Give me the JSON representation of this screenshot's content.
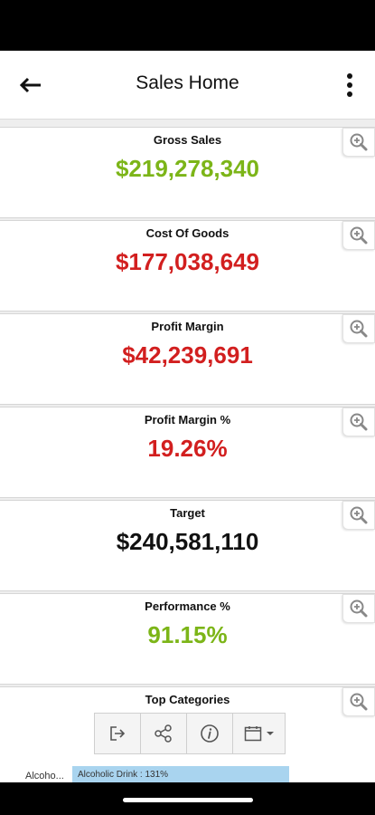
{
  "header": {
    "title": "Sales Home"
  },
  "colors": {
    "green": "#7cb518",
    "red": "#d21f1f",
    "black": "#111111"
  },
  "cards": [
    {
      "label": "Gross Sales",
      "value": "$219,278,340",
      "value_color": "#7cb518"
    },
    {
      "label": "Cost Of Goods",
      "value": "$177,038,649",
      "value_color": "#d21f1f"
    },
    {
      "label": "Profit Margin",
      "value": "$42,239,691",
      "value_color": "#d21f1f"
    },
    {
      "label": "Profit Margin %",
      "value": "19.26%",
      "value_color": "#d21f1f"
    },
    {
      "label": "Target",
      "value": "$240,581,110",
      "value_color": "#111111"
    },
    {
      "label": "Performance %",
      "value": "91.15%",
      "value_color": "#7cb518"
    },
    {
      "label": "Top Categories",
      "value": "",
      "value_color": "#111111"
    }
  ],
  "top_categories": {
    "first_label": "Alcoho...",
    "first_bar_text": "Alcoholic Drink : 131%"
  },
  "toolbar": {
    "icons": [
      "exit-icon",
      "share-icon",
      "info-icon",
      "calendar-icon",
      "dropdown-caret-icon"
    ]
  }
}
